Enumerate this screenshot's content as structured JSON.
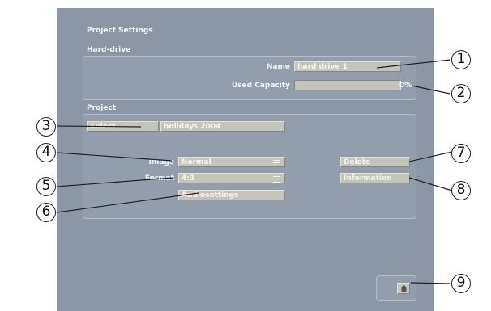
{
  "window": {
    "title": "Project Settings"
  },
  "hard_drive": {
    "section_title": "Hard-drive",
    "name_label": "Name",
    "name_value": "hard drive 1",
    "capacity_label": "Used Capacity",
    "capacity_percent_text": "0%",
    "capacity_fraction": 0
  },
  "project": {
    "section_title": "Project",
    "select_button": "Select",
    "project_name": "holidays 2004",
    "image_label": "Image",
    "image_value": "Normal",
    "format_label": "Format",
    "format_value": "4:3",
    "audiosettings_button": "Audiosettings",
    "delete_button": "Delete",
    "information_button": "Information"
  },
  "home": {
    "icon": "home-icon"
  },
  "callouts": [
    "1",
    "2",
    "3",
    "4",
    "5",
    "6",
    "7",
    "8",
    "9"
  ],
  "colors": {
    "panel": "#8c97a6",
    "field": "#c4c4ba",
    "text": "#f4f6f8"
  }
}
